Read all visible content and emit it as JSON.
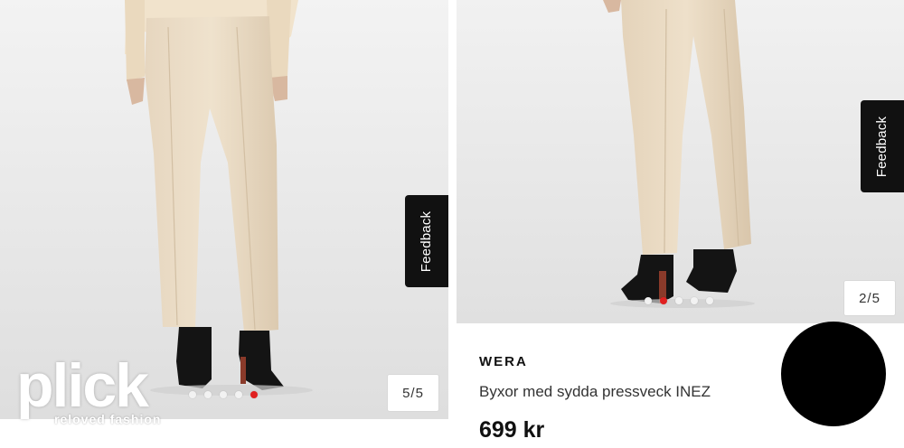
{
  "left_panel": {
    "feedback_label": "Feedback",
    "image_counter": "5/5",
    "carousel": {
      "total": 5,
      "active": 5
    },
    "logo": {
      "wordmark": "plick",
      "tagline": "reloved fashion"
    }
  },
  "right_panel": {
    "feedback_label": "Feedback",
    "image_counter": "2/5",
    "carousel": {
      "total": 5,
      "active": 2
    },
    "product": {
      "brand": "WERA",
      "title": "Byxor med sydda pressveck INEZ",
      "price": "699 kr"
    }
  },
  "colors": {
    "active_dot": "#e02020",
    "feedback_bg": "#111111",
    "photo_bg": "#ebebeb"
  }
}
